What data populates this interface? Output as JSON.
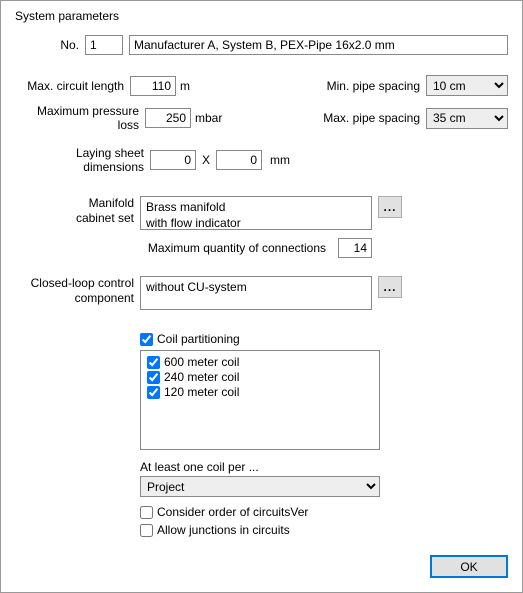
{
  "title": "System parameters",
  "labels": {
    "no": "No.",
    "maxCircuitLength": "Max. circuit length",
    "mUnit": "m",
    "minPipeSpacing": "Min. pipe spacing",
    "maxPressureLoss": "Maximum pressure loss",
    "mbarUnit": "mbar",
    "maxPipeSpacing": "Max. pipe spacing",
    "layingSheet": "Laying sheet dimensions",
    "x": "X",
    "mmUnit": "mm",
    "manifoldLine1": "Manifold",
    "manifoldLine2": "cabinet set",
    "maxConnections": "Maximum quantity of connections",
    "closedLoopLine1": "Closed-loop control",
    "closedLoopLine2": "component",
    "coilPartitioning": "Coil partitioning",
    "atLeastOne": "At least one coil per ...",
    "considerOrder": "Consider order of circuitsVer",
    "allowJunctions": "Allow junctions in circuits",
    "ok": "OK"
  },
  "values": {
    "no": "1",
    "systemName": "Manufacturer A, System B, PEX-Pipe 16x2.0 mm",
    "maxCircuitLength": "110",
    "minPipeSpacing": "10 cm",
    "maxPressureLoss": "250",
    "maxPipeSpacing": "35 cm",
    "sheetW": "0",
    "sheetH": "0",
    "manifoldLine1": "Brass manifold",
    "manifoldLine2": "with flow indicator",
    "maxConnections": "14",
    "closedLoop": "without CU-system",
    "atLeastOneSelected": "Project"
  },
  "coils": [
    {
      "label": "600 meter coil",
      "checked": true
    },
    {
      "label": "240 meter coil",
      "checked": true
    },
    {
      "label": "120 meter coil",
      "checked": true
    }
  ],
  "coilPartitioningChecked": true,
  "considerOrderChecked": false,
  "allowJunctionsChecked": false,
  "ellipsis": "..."
}
